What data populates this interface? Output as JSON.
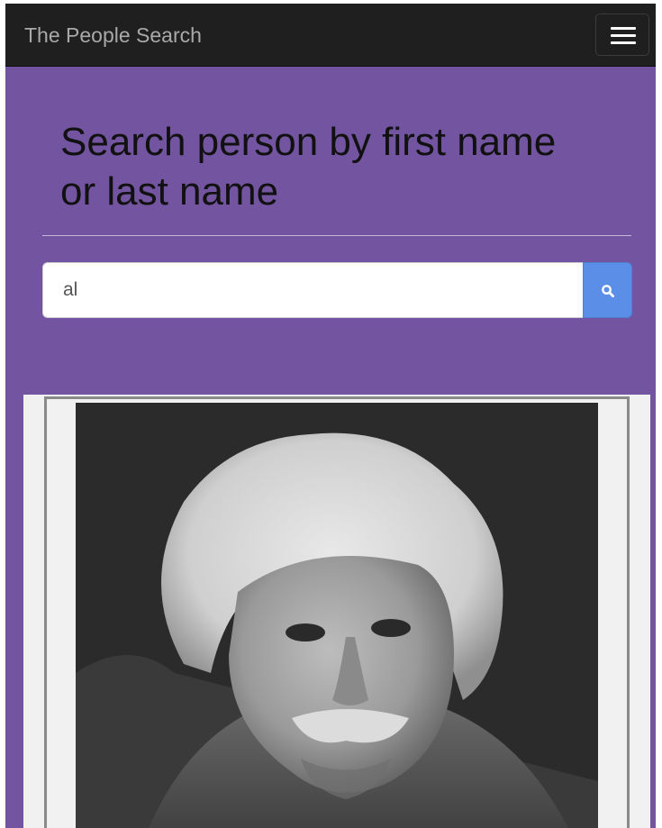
{
  "navbar": {
    "brand": "The People Search",
    "menu_icon": "hamburger-menu-icon"
  },
  "main": {
    "heading": "Search person by first name or last name"
  },
  "search": {
    "value": "al",
    "button_icon": "search-icon"
  },
  "results": {
    "items": [
      {
        "photo": "portrait-photo"
      }
    ]
  },
  "colors": {
    "navbar_bg": "#1f1f1f",
    "brand_text": "#a9a9a9",
    "page_bg": "#7354a0",
    "search_button": "#5b8ee6",
    "results_bg": "#f1f1f1"
  }
}
